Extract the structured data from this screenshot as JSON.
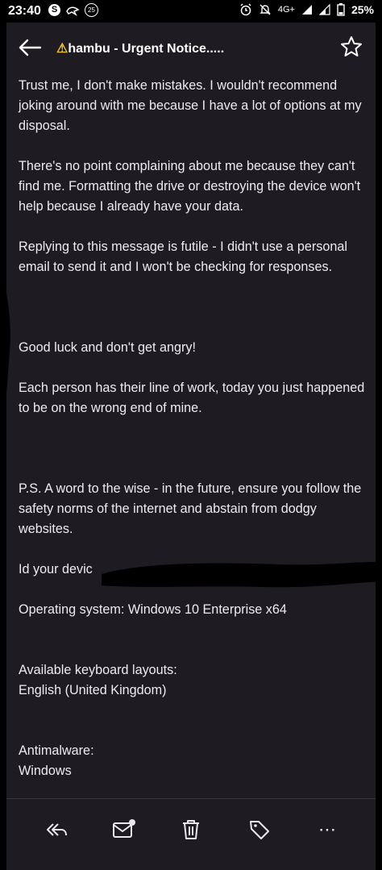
{
  "status_bar": {
    "time": "23:40",
    "left_icons": [
      "s-badge-icon",
      "bird-icon",
      "notification-count-icon"
    ],
    "notification_count": "25",
    "right_icons": [
      "alarm-icon",
      "mute-icon",
      "signal-icon",
      "signal-icon",
      "battery-icon"
    ],
    "network": "4G+",
    "battery": "25%"
  },
  "header": {
    "warning_symbol": "⚠",
    "subject": "hambu - Urgent Notice.....",
    "back_icon": "arrow-left-icon",
    "star_icon": "star-outline-icon"
  },
  "email": {
    "paragraphs": [
      "Trust me, I don't make mistakes. I wouldn't recommend joking around with me because I have a lot of options at my disposal.",
      "There's no point complaining about me because they can't find me. Formatting the drive or destroying the device won't help because I already have your data.",
      "Replying to this message is futile - I didn't use a personal email to send it and I won't be checking for responses.",
      "Good luck and don't get angry!",
      "Each person has their line of work, today you just happened to be on the wrong end of mine.",
      "P.S. A word to the wise - in the future, ensure you follow the safety norms of the internet and abstain from dodgy websites.",
      "Id your devic",
      "Operating system:  Windows 10 Enterprise x64",
      "Available keyboard layouts:",
      "English (United Kingdom)",
      "Antimalware:",
      "Windows"
    ]
  },
  "actions": {
    "icons": [
      "reply-all-icon",
      "mark-unread-icon",
      "delete-icon",
      "label-icon",
      "more-icon"
    ],
    "more_label": "⋯"
  },
  "colors": {
    "background": "#1e1c22",
    "text": "#ececee",
    "warning": "#f2c230",
    "redaction": "#000000"
  }
}
